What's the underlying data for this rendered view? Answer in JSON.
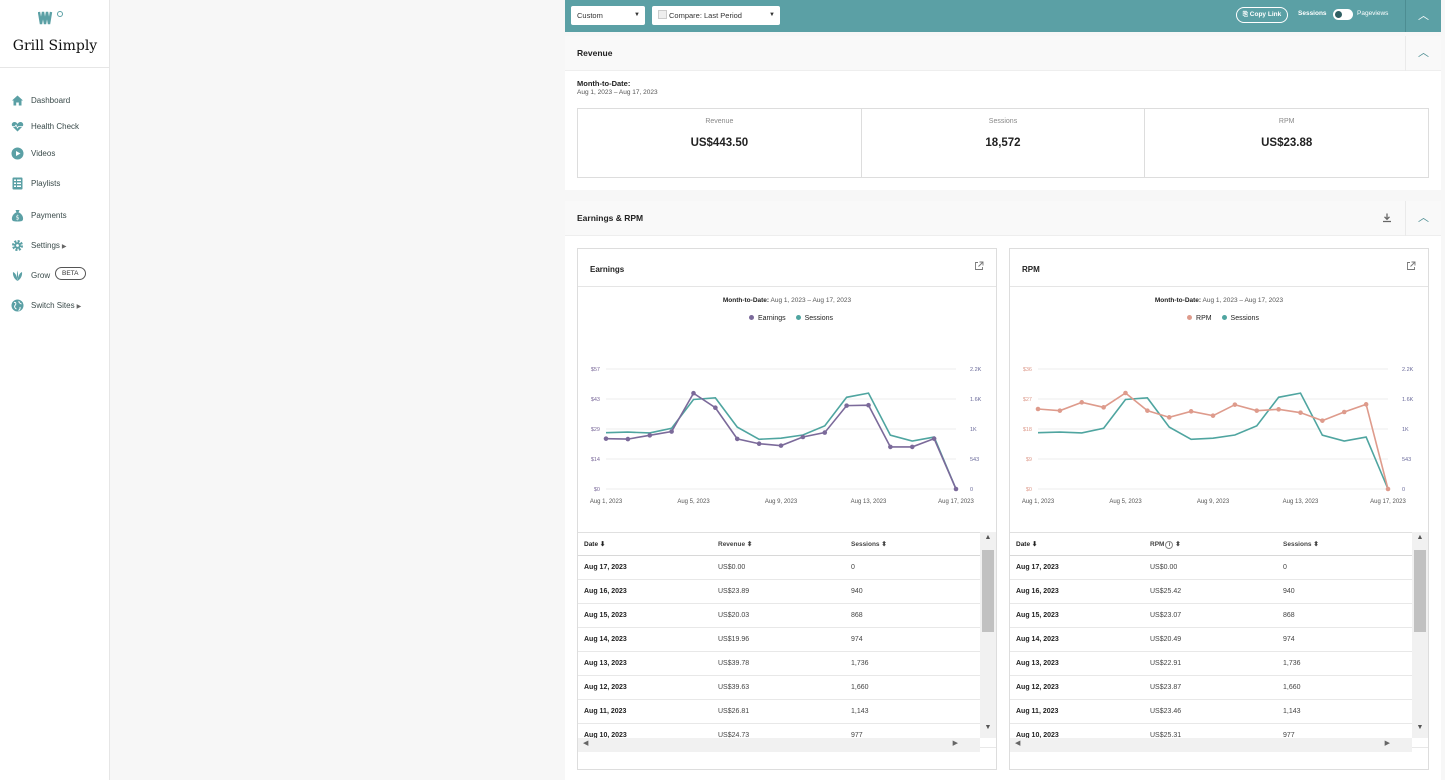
{
  "brand": {
    "name": "Grill Simply"
  },
  "sidebar": {
    "items": [
      {
        "label": "Dashboard",
        "icon": "home-icon"
      },
      {
        "label": "Health Check",
        "icon": "heart-icon"
      },
      {
        "label": "Videos",
        "icon": "play-icon"
      },
      {
        "label": "Playlists",
        "icon": "list-icon"
      },
      {
        "label": "Payments",
        "icon": "money-bag-icon"
      },
      {
        "label": "Settings",
        "icon": "gear-icon"
      },
      {
        "label": "Grow",
        "icon": "leaf-icon",
        "badge": "BETA"
      },
      {
        "label": "Switch Sites",
        "icon": "globe-icon"
      }
    ]
  },
  "toolbar": {
    "range": "Custom",
    "compare": "Compare: Last Period",
    "copy_link": "Copy Link",
    "toggle_left": "Sessions",
    "toggle_right": "Pageviews"
  },
  "revenue_card": {
    "title": "Revenue",
    "mtd_label": "Month-to-Date:",
    "mtd_range": "Aug 1, 2023 – Aug 17, 2023",
    "stats": [
      {
        "label": "Revenue",
        "value": "US$443.50"
      },
      {
        "label": "Sessions",
        "value": "18,572"
      },
      {
        "label": "RPM",
        "value": "US$23.88"
      }
    ]
  },
  "earnings_card": {
    "title": "Earnings & RPM"
  },
  "colors": {
    "accent": "#5ba0a5",
    "earnings": "#7b6a9a",
    "sessions": "#4fa5a0",
    "rpm": "#de9b8c"
  },
  "charts": [
    {
      "title": "Earnings",
      "mtd_label": "Month-to-Date:",
      "mtd_range": "Aug 1, 2023 – Aug 17, 2023",
      "legend": [
        "Earnings",
        "Sessions"
      ],
      "table_headers": [
        "Date",
        "Revenue",
        "Sessions"
      ],
      "rows": [
        [
          "Aug 17, 2023",
          "US$0.00",
          "0"
        ],
        [
          "Aug 16, 2023",
          "US$23.89",
          "940"
        ],
        [
          "Aug 15, 2023",
          "US$20.03",
          "868"
        ],
        [
          "Aug 14, 2023",
          "US$19.96",
          "974"
        ],
        [
          "Aug 13, 2023",
          "US$39.78",
          "1,736"
        ],
        [
          "Aug 12, 2023",
          "US$39.63",
          "1,660"
        ],
        [
          "Aug 11, 2023",
          "US$26.81",
          "1,143"
        ],
        [
          "Aug 10, 2023",
          "US$24.73",
          "977"
        ]
      ]
    },
    {
      "title": "RPM",
      "mtd_label": "Month-to-Date:",
      "mtd_range": "Aug 1, 2023 – Aug 17, 2023",
      "legend": [
        "RPM",
        "Sessions"
      ],
      "table_headers": [
        "Date",
        "RPM",
        "Sessions"
      ],
      "rows": [
        [
          "Aug 17, 2023",
          "US$0.00",
          "0"
        ],
        [
          "Aug 16, 2023",
          "US$25.42",
          "940"
        ],
        [
          "Aug 15, 2023",
          "US$23.07",
          "868"
        ],
        [
          "Aug 14, 2023",
          "US$20.49",
          "974"
        ],
        [
          "Aug 13, 2023",
          "US$22.91",
          "1,736"
        ],
        [
          "Aug 12, 2023",
          "US$23.87",
          "1,660"
        ],
        [
          "Aug 11, 2023",
          "US$23.46",
          "1,143"
        ],
        [
          "Aug 10, 2023",
          "US$25.31",
          "977"
        ]
      ]
    }
  ],
  "chart_data": [
    {
      "type": "line",
      "x": [
        "Aug 1, 2023",
        "Aug 2, 2023",
        "Aug 3, 2023",
        "Aug 4, 2023",
        "Aug 5, 2023",
        "Aug 6, 2023",
        "Aug 7, 2023",
        "Aug 8, 2023",
        "Aug 9, 2023",
        "Aug 10, 2023",
        "Aug 11, 2023",
        "Aug 12, 2023",
        "Aug 13, 2023",
        "Aug 14, 2023",
        "Aug 15, 2023",
        "Aug 16, 2023",
        "Aug 17, 2023"
      ],
      "xticks": [
        "Aug 1, 2023",
        "Aug 5, 2023",
        "Aug 9, 2023",
        "Aug 13, 2023",
        "Aug 17, 2023"
      ],
      "y_left_ticks": [
        "$0",
        "$14",
        "$29",
        "$43",
        "$57"
      ],
      "y_right_ticks": [
        "0",
        "543",
        "1K",
        "1.6K",
        "2.2K"
      ],
      "ylim_left": [
        0,
        57
      ],
      "ylim_right": [
        0,
        2172
      ],
      "series": [
        {
          "name": "Earnings",
          "axis": "left",
          "markers": true,
          "values": [
            23.9,
            23.7,
            25.5,
            27.3,
            45.5,
            38.6,
            23.8,
            21.5,
            20.6,
            24.7,
            26.8,
            39.6,
            39.8,
            20.0,
            20.0,
            23.9,
            0
          ]
        },
        {
          "name": "Sessions",
          "axis": "right",
          "markers": false,
          "values": [
            1020,
            1030,
            1015,
            1100,
            1620,
            1650,
            1120,
            900,
            920,
            977,
            1143,
            1660,
            1736,
            974,
            868,
            940,
            0
          ]
        }
      ]
    },
    {
      "type": "line",
      "x": [
        "Aug 1, 2023",
        "Aug 2, 2023",
        "Aug 3, 2023",
        "Aug 4, 2023",
        "Aug 5, 2023",
        "Aug 6, 2023",
        "Aug 7, 2023",
        "Aug 8, 2023",
        "Aug 9, 2023",
        "Aug 10, 2023",
        "Aug 11, 2023",
        "Aug 12, 2023",
        "Aug 13, 2023",
        "Aug 14, 2023",
        "Aug 15, 2023",
        "Aug 16, 2023",
        "Aug 17, 2023"
      ],
      "xticks": [
        "Aug 1, 2023",
        "Aug 5, 2023",
        "Aug 9, 2023",
        "Aug 13, 2023",
        "Aug 17, 2023"
      ],
      "y_left_ticks": [
        "$0",
        "$9",
        "$18",
        "$27",
        "$36"
      ],
      "y_right_ticks": [
        "0",
        "543",
        "1K",
        "1.6K",
        "2.2K"
      ],
      "ylim_left": [
        0,
        36
      ],
      "ylim_right": [
        0,
        2172
      ],
      "series": [
        {
          "name": "RPM",
          "axis": "left",
          "markers": true,
          "values": [
            24.0,
            23.5,
            26.0,
            24.5,
            28.8,
            23.5,
            21.5,
            23.3,
            22.0,
            25.3,
            23.5,
            23.9,
            22.9,
            20.5,
            23.1,
            25.4,
            0
          ]
        },
        {
          "name": "Sessions",
          "axis": "right",
          "markers": false,
          "values": [
            1020,
            1030,
            1015,
            1100,
            1620,
            1650,
            1120,
            900,
            920,
            977,
            1143,
            1660,
            1736,
            974,
            868,
            940,
            0
          ]
        }
      ]
    }
  ]
}
